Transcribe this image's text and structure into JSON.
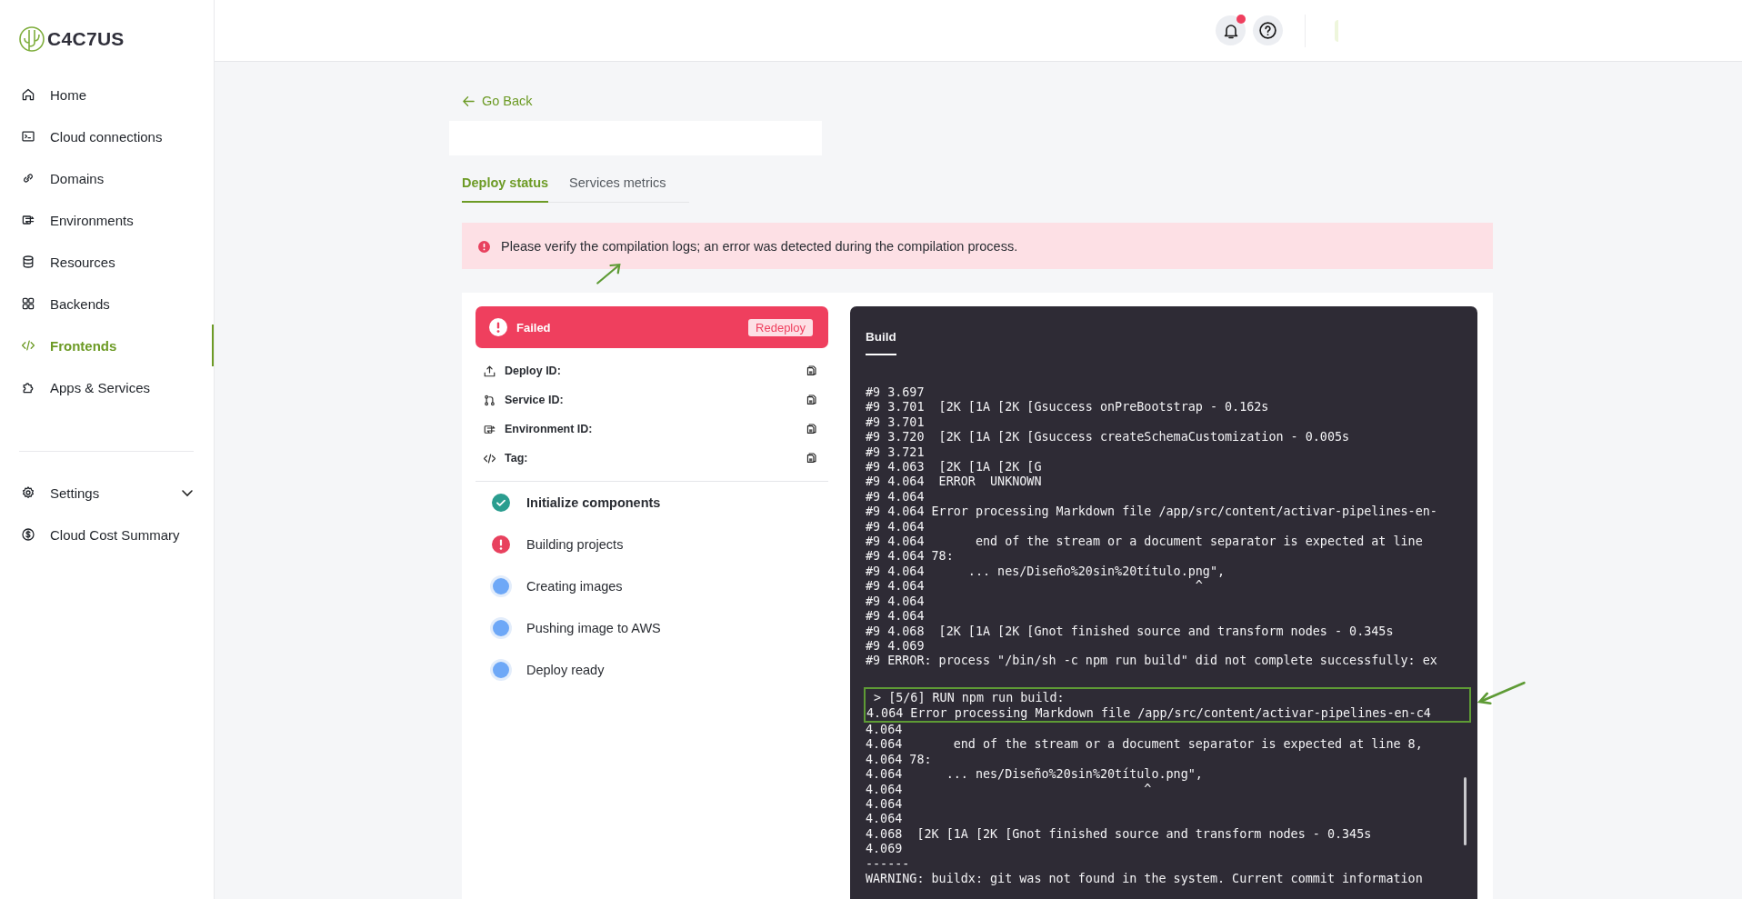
{
  "brand": {
    "name": "C4C7US"
  },
  "sidebar": {
    "items": [
      {
        "label": "Home",
        "selected": false
      },
      {
        "label": "Cloud connections",
        "selected": false
      },
      {
        "label": "Domains",
        "selected": false
      },
      {
        "label": "Environments",
        "selected": false
      },
      {
        "label": "Resources",
        "selected": false
      },
      {
        "label": "Backends",
        "selected": false
      },
      {
        "label": "Frontends",
        "selected": true
      },
      {
        "label": "Apps & Services",
        "selected": false
      }
    ],
    "bottom_items": [
      {
        "label": "Settings",
        "expanded": false
      },
      {
        "label": "Cloud Cost Summary"
      }
    ]
  },
  "header": {
    "notifications": {
      "unread": true
    }
  },
  "back_link": "Go Back",
  "tabs": [
    {
      "label": "Deploy status",
      "selected": true
    },
    {
      "label": "Services metrics",
      "selected": false
    }
  ],
  "alert": {
    "message": "Please verify the compilation logs; an error was detected during the compilation process."
  },
  "deploy": {
    "status": {
      "label": "Failed",
      "action": "Redeploy"
    },
    "details": [
      {
        "label": "Deploy ID:"
      },
      {
        "label": "Service ID:"
      },
      {
        "label": "Environment ID:"
      },
      {
        "label": "Tag:"
      }
    ],
    "steps": [
      {
        "label": "Initialize components",
        "kind": "done"
      },
      {
        "label": "Building projects",
        "kind": "error"
      },
      {
        "label": "Creating images",
        "kind": "pending"
      },
      {
        "label": "Pushing image to AWS",
        "kind": "pending"
      },
      {
        "label": "Deploy ready",
        "kind": "pending"
      }
    ]
  },
  "log": {
    "tab": "Build",
    "lines": [
      {
        "text": "#9 3.697",
        "highlighted": false
      },
      {
        "text": "#9 3.701  [2K [1A [2K [Gsuccess onPreBootstrap - 0.162s",
        "highlighted": false
      },
      {
        "text": "#9 3.701",
        "highlighted": false
      },
      {
        "text": "#9 3.720  [2K [1A [2K [Gsuccess createSchemaCustomization - 0.005s",
        "highlighted": false
      },
      {
        "text": "#9 3.721",
        "highlighted": false
      },
      {
        "text": "#9 4.063  [2K [1A [2K [G",
        "highlighted": false
      },
      {
        "text": "#9 4.064  ERROR  UNKNOWN",
        "highlighted": false
      },
      {
        "text": "#9 4.064",
        "highlighted": false
      },
      {
        "text": "#9 4.064 Error processing Markdown file /app/src/content/activar-pipelines-en-",
        "highlighted": false
      },
      {
        "text": "#9 4.064",
        "highlighted": false
      },
      {
        "text": "#9 4.064       end of the stream or a document separator is expected at line",
        "highlighted": false
      },
      {
        "text": "#9 4.064 78:",
        "highlighted": false
      },
      {
        "text": "#9 4.064      ... nes/Diseño%20sin%20título.png\",",
        "highlighted": false
      },
      {
        "text": "#9 4.064                                     ^",
        "highlighted": false
      },
      {
        "text": "#9 4.064",
        "highlighted": false
      },
      {
        "text": "#9 4.064",
        "highlighted": false
      },
      {
        "text": "#9 4.068  [2K [1A [2K [Gnot finished source and transform nodes - 0.345s",
        "highlighted": false
      },
      {
        "text": "#9 4.069",
        "highlighted": false
      },
      {
        "text": "#9 ERROR: process \"/bin/sh -c npm run build\" did not complete successfully: ex",
        "highlighted": false
      },
      {
        "highlighted": false
      },
      {
        "text": " > [5/6] RUN npm run build:",
        "highlighted": true
      },
      {
        "text": "4.064 Error processing Markdown file /app/src/content/activar-pipelines-en-c4",
        "highlighted": true
      },
      {
        "text": "4.064",
        "highlighted": false
      },
      {
        "text": "4.064       end of the stream or a document separator is expected at line 8,",
        "highlighted": false
      },
      {
        "text": "4.064 78:",
        "highlighted": false
      },
      {
        "text": "4.064      ... nes/Diseño%20sin%20título.png\",",
        "highlighted": false
      },
      {
        "text": "4.064                                 ^",
        "highlighted": false
      },
      {
        "text": "4.064",
        "highlighted": false
      },
      {
        "text": "4.064",
        "highlighted": false
      },
      {
        "text": "4.068  [2K [1A [2K [Gnot finished source and transform nodes - 0.345s",
        "highlighted": false
      },
      {
        "text": "4.069",
        "highlighted": false
      },
      {
        "text": "------",
        "highlighted": false
      },
      {
        "text": "WARNING: buildx: git was not found in the system. Current commit information",
        "highlighted": false
      }
    ]
  }
}
